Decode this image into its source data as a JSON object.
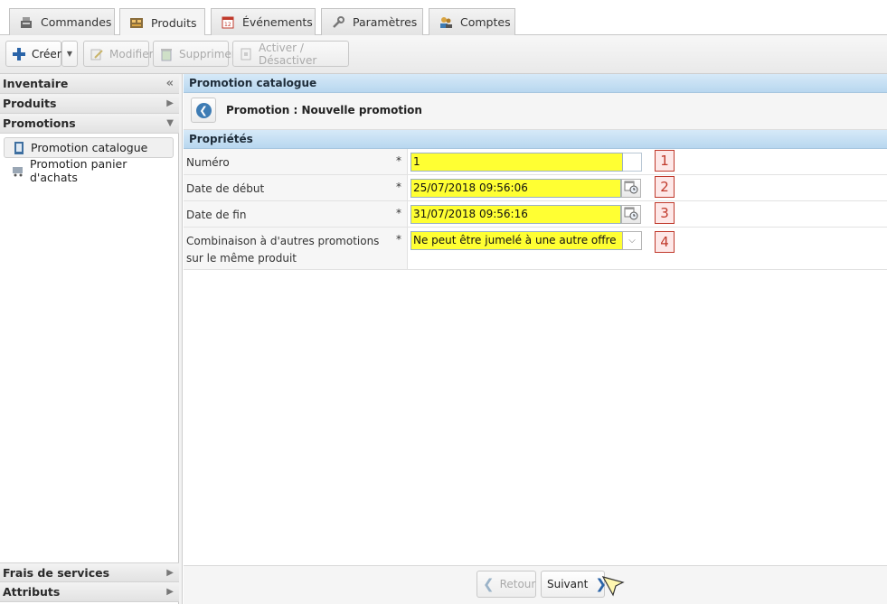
{
  "tabs": [
    {
      "label": "Commandes",
      "icon": "cash-register-icon"
    },
    {
      "label": "Produits",
      "icon": "products-box-icon",
      "active": true
    },
    {
      "label": "Événements",
      "icon": "calendar-icon"
    },
    {
      "label": "Paramètres",
      "icon": "wrench-icon"
    },
    {
      "label": "Comptes",
      "icon": "users-icon"
    }
  ],
  "toolbar": {
    "create_label": "Créer",
    "edit_label": "Modifier",
    "delete_label": "Supprimer",
    "toggle_label": "Activer / Désactiver"
  },
  "sidebar": {
    "sections": {
      "inventaire": "Inventaire",
      "produits": "Produits",
      "promotions": "Promotions",
      "frais": "Frais de services",
      "attributs": "Attributs"
    },
    "items": [
      {
        "label": "Promotion catalogue",
        "selected": true
      },
      {
        "label": "Promotion panier d'achats",
        "selected": false
      }
    ]
  },
  "main": {
    "header": "Promotion catalogue",
    "nav_title": "Promotion : Nouvelle promotion",
    "properties_header": "Propriétés",
    "required_mark": "*",
    "fields": {
      "numero": {
        "label": "Numéro",
        "value": "1",
        "step": "1"
      },
      "date_debut": {
        "label": "Date de début",
        "value": "25/07/2018 09:56:06",
        "step": "2"
      },
      "date_fin": {
        "label": "Date de fin",
        "value": "31/07/2018 09:56:16",
        "step": "3"
      },
      "combinaison": {
        "label": "Combinaison à d'autres promotions sur le même produit",
        "value": "Ne peut être jumelé à une autre offre",
        "step": "4"
      }
    },
    "footer": {
      "back_label": "Retour",
      "next_label": "Suivant"
    }
  },
  "colors": {
    "highlight": "#ffff33",
    "section_header": "#c8e0f4",
    "step_badge": "#c0392b"
  }
}
